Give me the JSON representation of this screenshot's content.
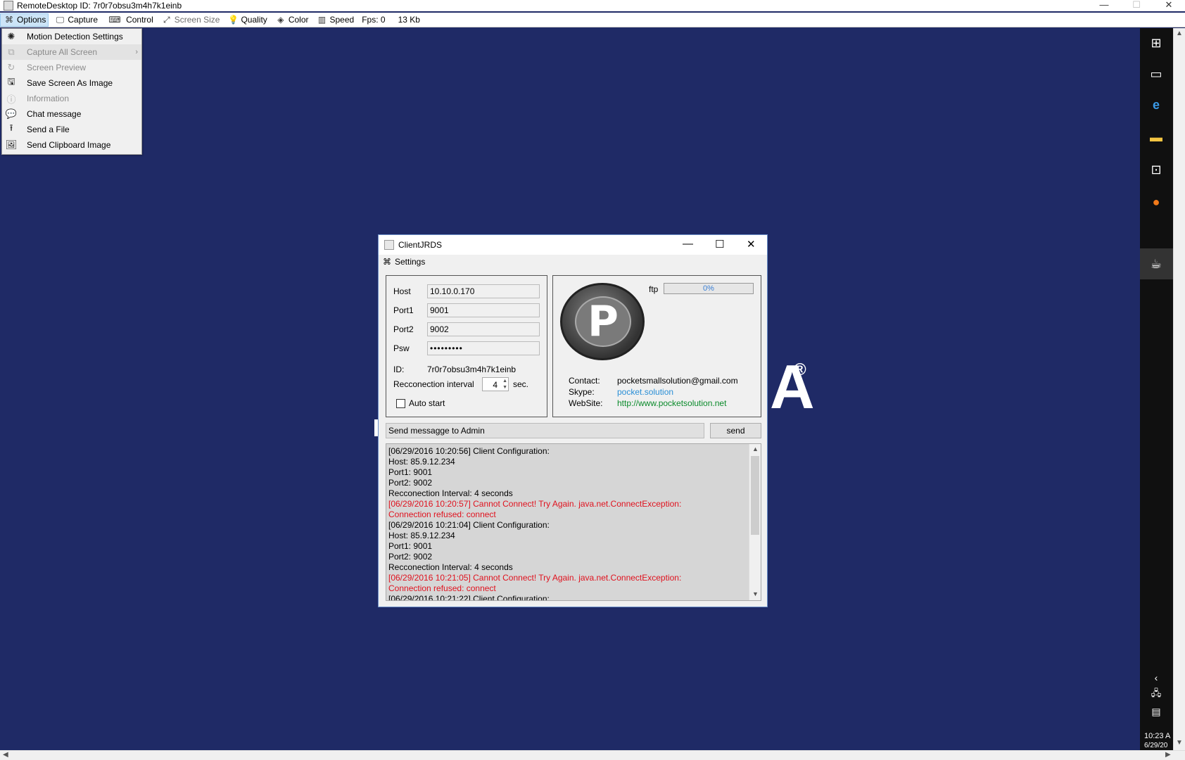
{
  "window": {
    "title": "RemoteDesktop ID: 7r0r7obsu3m4h7k1einb",
    "minimize": "—",
    "maximize": "☐",
    "close": "✕"
  },
  "menubar": {
    "options": "Options",
    "capture": "Capture",
    "control": "Control",
    "screen_size": "Screen Size",
    "quality": "Quality",
    "color": "Color",
    "speed": "Speed",
    "fps": "Fps: 0",
    "size": "13 Kb"
  },
  "options_menu": {
    "items": [
      {
        "label": "Motion Detection Settings",
        "icon": "spinner-icon"
      },
      {
        "label": "Capture All Screen",
        "icon": "screens-icon"
      },
      {
        "label": "Screen Preview",
        "icon": "refresh-icon"
      },
      {
        "label": "Save Screen As Image",
        "icon": "save-icon"
      },
      {
        "label": "Information",
        "icon": "info-icon"
      },
      {
        "label": "Chat message",
        "icon": "chat-icon"
      },
      {
        "label": "Send a File",
        "icon": "upload-icon"
      },
      {
        "label": "Send Clipboard Image",
        "icon": "image-icon"
      }
    ]
  },
  "client": {
    "title": "ClientJRDS",
    "menu": "Settings",
    "host_label": "Host",
    "host_value": "10.10.0.170",
    "port1_label": "Port1",
    "port1_value": "9001",
    "port2_label": "Port2",
    "port2_value": "9002",
    "psw_label": "Psw",
    "psw_value": "•••••••••",
    "id_label": "ID:",
    "id_value": "7r0r7obsu3m4h7k1einb",
    "reconnect_label": "Recconection interval",
    "reconnect_value": "4",
    "reconnect_unit": "sec.",
    "autostart_label": "Auto start",
    "ftp_label": "ftp",
    "ftp_progress": "0%",
    "contact_label": "Contact:",
    "contact_value": "pocketsmallsolution@gmail.com",
    "skype_label": "Skype:",
    "skype_value": "pocket.solution",
    "website_label": "WebSite:",
    "website_value": "http://www.pocketsolution.net",
    "message_placeholder": "Send messagge to Admin",
    "send_label": "send",
    "logo_letter": "P"
  },
  "log": [
    {
      "text": "[06/29/2016 10:20:56] Client Configuration:",
      "error": false
    },
    {
      "text": "Host: 85.9.12.234",
      "error": false
    },
    {
      "text": "Port1: 9001",
      "error": false
    },
    {
      "text": "Port2: 9002",
      "error": false
    },
    {
      "text": "Recconection Interval: 4 seconds",
      "error": false
    },
    {
      "text": "[06/29/2016 10:20:57] Cannot Connect! Try Again. java.net.ConnectException:",
      "error": true
    },
    {
      "text": "Connection refused: connect",
      "error": true
    },
    {
      "text": "[06/29/2016 10:21:04] Client Configuration:",
      "error": false
    },
    {
      "text": "Host: 85.9.12.234",
      "error": false
    },
    {
      "text": "Port1: 9001",
      "error": false
    },
    {
      "text": "Port2: 9002",
      "error": false
    },
    {
      "text": "Recconection Interval: 4 seconds",
      "error": false
    },
    {
      "text": "[06/29/2016 10:21:05] Cannot Connect! Try Again. java.net.ConnectException:",
      "error": true
    },
    {
      "text": "Connection refused: connect",
      "error": true
    },
    {
      "text": "[06/29/2016 10:21:22] Client Configuration:",
      "error": false
    }
  ],
  "taskbar": {
    "clock_time": "10:23 A",
    "clock_date": "6/29/20"
  },
  "colors": {
    "desktop": "#1f2a66",
    "error": "#e0121e",
    "link_blue": "#2b8fd6",
    "link_green": "#0a8a2a"
  }
}
